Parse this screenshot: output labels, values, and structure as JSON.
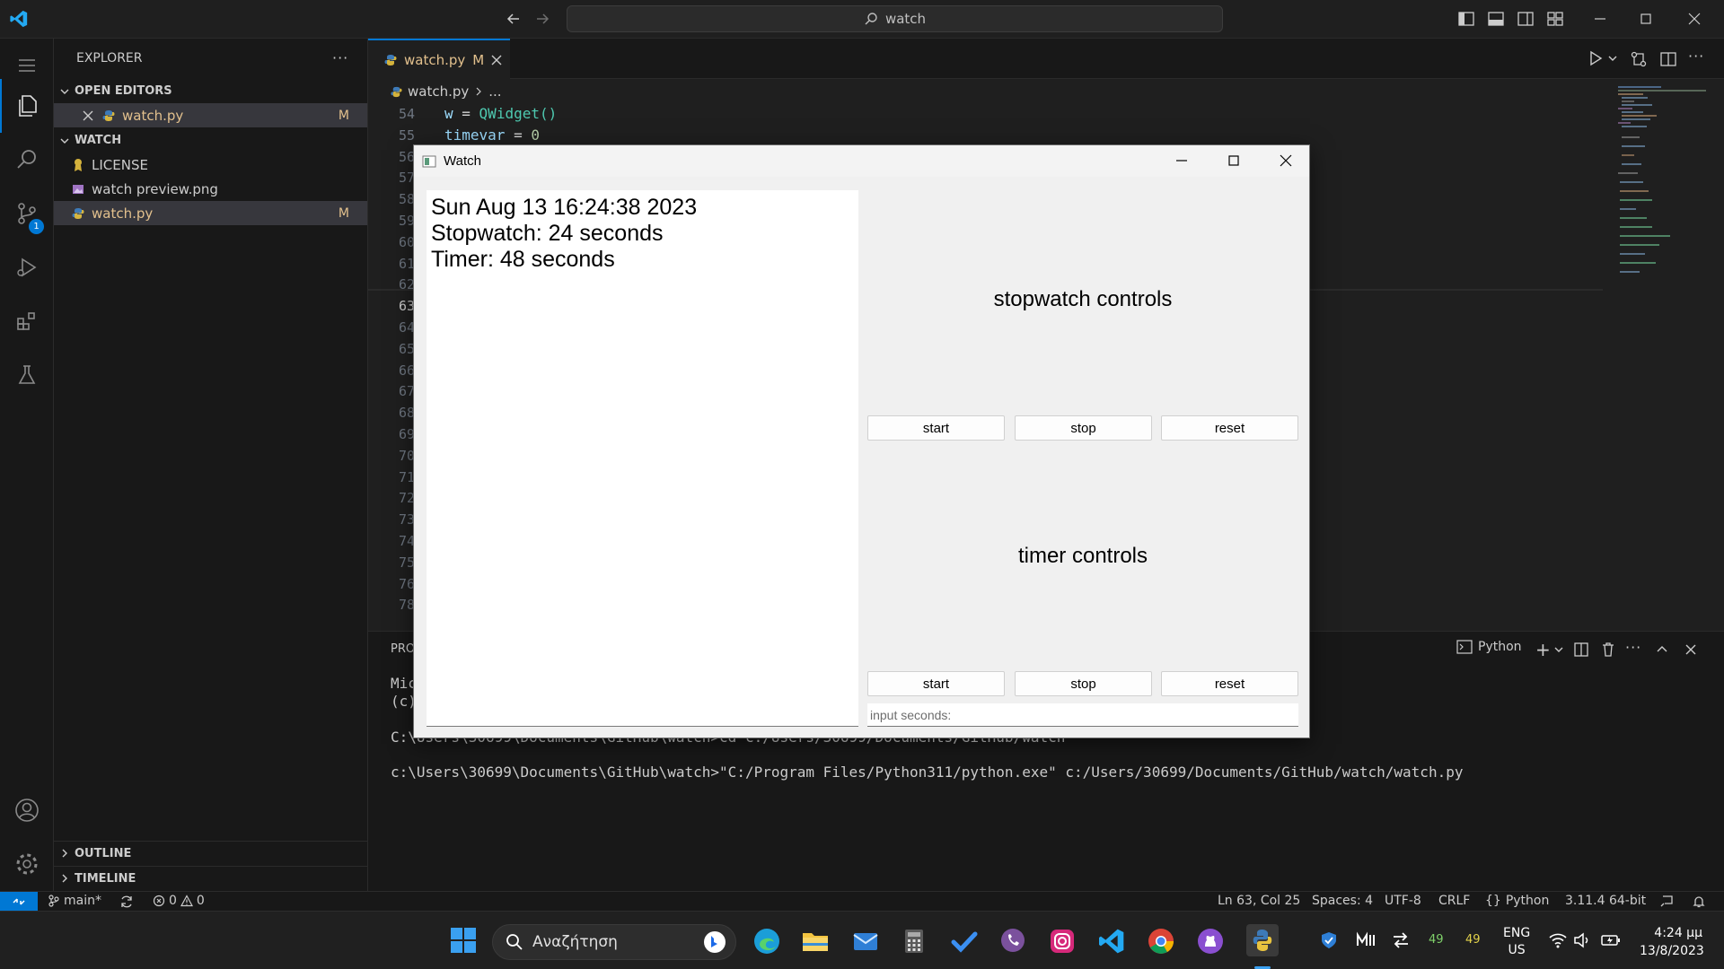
{
  "titlebar": {
    "search_text": "watch"
  },
  "sidebar": {
    "title": "EXPLORER",
    "open_editors_header": "OPEN EDITORS",
    "open_editor_file": "watch.py",
    "open_editor_badge": "M",
    "folder_header": "WATCH",
    "files": [
      {
        "name": "LICENSE",
        "badge": ""
      },
      {
        "name": "watch preview.png",
        "badge": ""
      },
      {
        "name": "watch.py",
        "badge": "M"
      }
    ],
    "outline": "OUTLINE",
    "timeline": "TIMELINE"
  },
  "activity": {
    "scm_badge": "1"
  },
  "editor": {
    "tab_label": "watch.py",
    "tab_badge": "M",
    "breadcrumb_file": "watch.py",
    "breadcrumb_more": "...",
    "lines": [
      {
        "no": "54",
        "code": "w = QWidget()"
      },
      {
        "no": "55",
        "code": "timevar = 0"
      },
      {
        "no": "56",
        "code": ""
      },
      {
        "no": "57",
        "code": ""
      },
      {
        "no": "58",
        "code": ""
      },
      {
        "no": "59",
        "code": ""
      },
      {
        "no": "60",
        "code": ""
      },
      {
        "no": "61",
        "code": ""
      },
      {
        "no": "62",
        "code": ""
      },
      {
        "no": "63",
        "code": ""
      },
      {
        "no": "64",
        "code": ""
      },
      {
        "no": "65",
        "code": ""
      },
      {
        "no": "66",
        "code": ""
      },
      {
        "no": "67",
        "code": ""
      },
      {
        "no": "68",
        "code": ""
      },
      {
        "no": "69",
        "code": ""
      },
      {
        "no": "70",
        "code": ""
      },
      {
        "no": "71",
        "code": ""
      },
      {
        "no": "72",
        "code": ""
      },
      {
        "no": "73",
        "code": ""
      },
      {
        "no": "74",
        "code": ""
      },
      {
        "no": "75",
        "code": ""
      },
      {
        "no": "76",
        "code": ""
      },
      {
        "no": "78",
        "code": ""
      }
    ]
  },
  "panel": {
    "tab_partial": "PRO",
    "terminal_type": "Python",
    "terminal_lines": [
      "Mic",
      "(c)",
      "C:\\Users\\30699\\Documents\\GitHub\\watch>cd c:/Users/30699/Documents/GitHub/watch",
      "c:\\Users\\30699\\Documents\\GitHub\\watch>\"C:/Program Files/Python311/python.exe\" c:/Users/30699/Documents/GitHub/watch/watch.py"
    ]
  },
  "statusbar": {
    "branch": "main*",
    "errors": "0",
    "warnings": "0",
    "position": "Ln 63, Col 25",
    "spaces": "Spaces: 4",
    "encoding": "UTF-8",
    "eol": "CRLF",
    "language": "Python",
    "interpreter": "3.11.4 64-bit"
  },
  "taskbar": {
    "search_placeholder": "Αναζήτηση",
    "tray_num1": "49",
    "tray_num2": "49",
    "lang1": "ENG",
    "lang2": "US",
    "time": "4:24 μμ",
    "date": "13/8/2023"
  },
  "watch_app": {
    "title": "Watch",
    "display_lines": [
      "Sun Aug 13 16:24:38 2023",
      "Stopwatch: 24 seconds",
      "Timer: 48 seconds"
    ],
    "stopwatch_label": "stopwatch controls",
    "timer_label": "timer controls",
    "start_label": "start",
    "stop_label": "stop",
    "reset_label": "reset",
    "input_placeholder": "input seconds:"
  },
  "colors": {
    "accent": "#0078d4",
    "modified": "#e2c08d"
  }
}
